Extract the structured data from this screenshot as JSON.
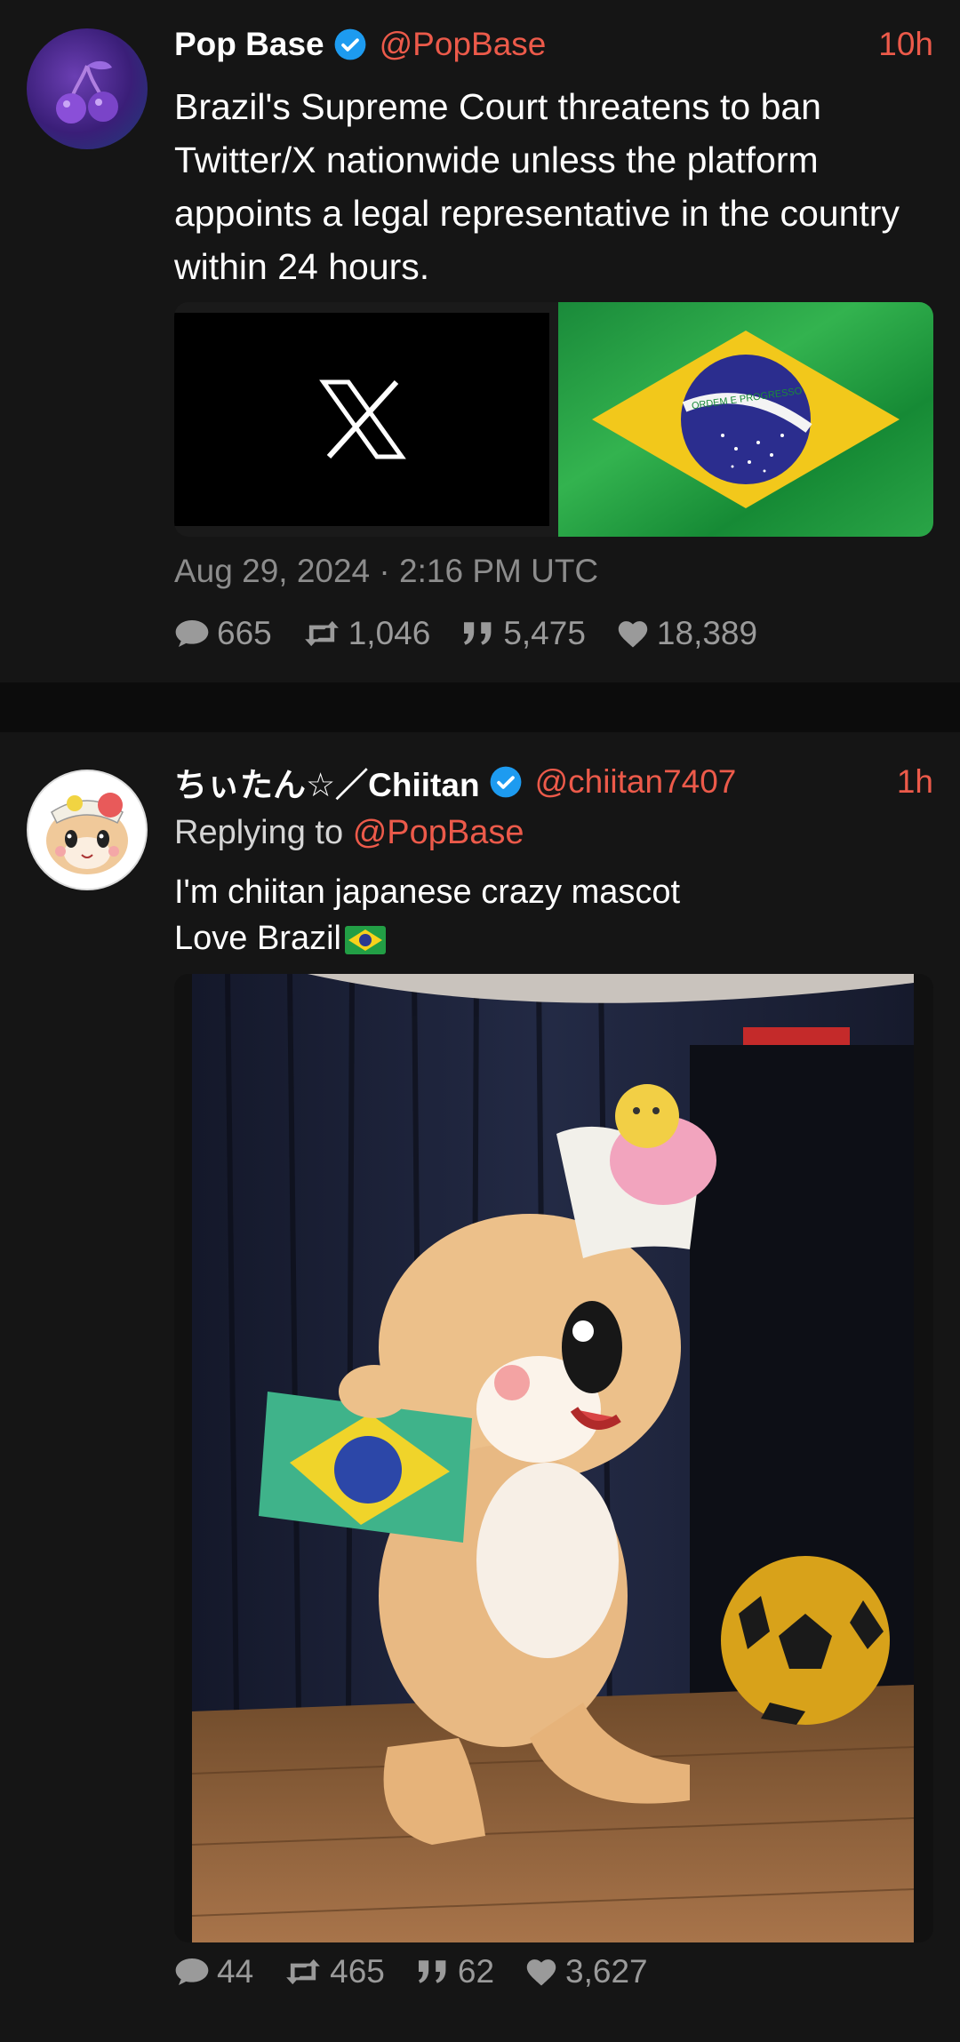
{
  "tweets": [
    {
      "author": "Pop Base",
      "handle": "@PopBase",
      "time": "10h",
      "text": "Brazil's Supreme Court threatens to ban Twitter/X nationwide unless the platform appoints a legal representative in the country within 24 hours.",
      "date": "Aug 29, 2024 · 2:16 PM UTC",
      "stats": {
        "replies": "665",
        "retweets": "1,046",
        "quotes": "5,475",
        "likes": "18,389"
      },
      "flag_motto": "ORDEM E PROGRESSO"
    },
    {
      "author": "ちぃたん☆／Chiitan",
      "handle": "@chiitan7407",
      "time": "1h",
      "replying_label": "Replying to",
      "replying_to": "@PopBase",
      "text_line1": "I'm chiitan japanese crazy mascot",
      "text_line2": "Love Brazil",
      "stats": {
        "replies": "44",
        "retweets": "465",
        "quotes": "62",
        "likes": "3,627"
      }
    }
  ],
  "colors": {
    "accent": "#ec5a4a",
    "verified": "#1d9bf0",
    "background": "#151515"
  }
}
